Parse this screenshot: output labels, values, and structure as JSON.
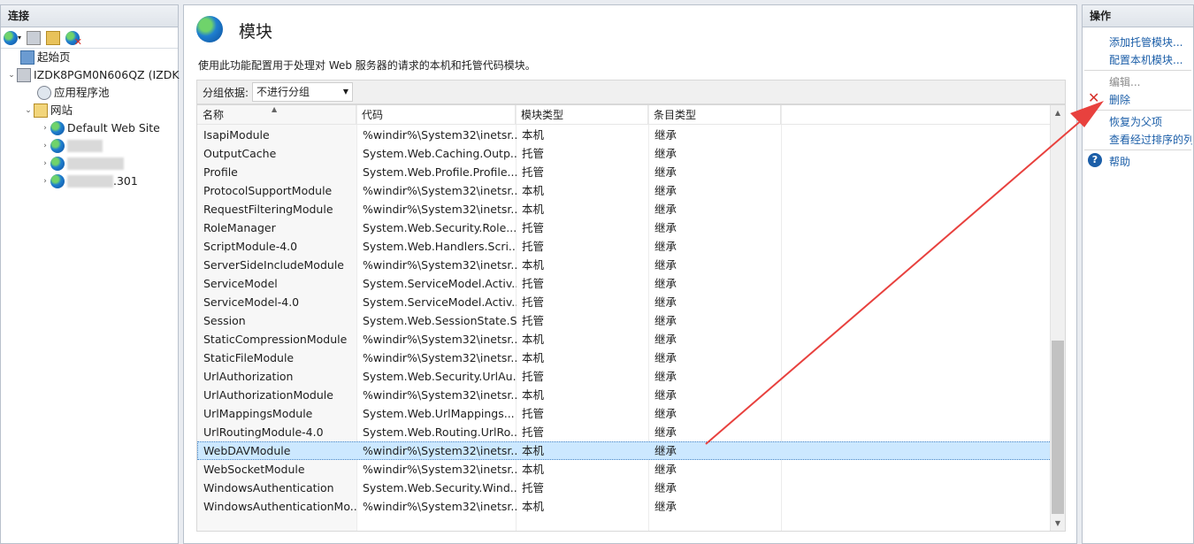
{
  "connections": {
    "title": "连接",
    "toolbar_icons": [
      "connect-globe-icon",
      "save-icon",
      "up-folder-icon",
      "disconnect-icon"
    ],
    "tree": {
      "start_page": "起始页",
      "server": "IZDK8PGM0N606QZ (IZDK",
      "app_pools": "应用程序池",
      "sites": "网站",
      "default_site": "Default Web Site",
      "site_blurred_3_suffix": ".301"
    }
  },
  "main": {
    "title": "模块",
    "description": "使用此功能配置用于处理对 Web 服务器的请求的本机和托管代码模块。",
    "group_label": "分组依据:",
    "group_value": "不进行分组",
    "columns": [
      "名称",
      "代码",
      "模块类型",
      "条目类型"
    ],
    "rows": [
      {
        "name": "IsapiModule",
        "code": "%windir%\\System32\\inetsr...",
        "type": "本机",
        "entry": "继承"
      },
      {
        "name": "OutputCache",
        "code": "System.Web.Caching.Outp...",
        "type": "托管",
        "entry": "继承"
      },
      {
        "name": "Profile",
        "code": "System.Web.Profile.Profile...",
        "type": "托管",
        "entry": "继承"
      },
      {
        "name": "ProtocolSupportModule",
        "code": "%windir%\\System32\\inetsr...",
        "type": "本机",
        "entry": "继承"
      },
      {
        "name": "RequestFilteringModule",
        "code": "%windir%\\System32\\inetsr...",
        "type": "本机",
        "entry": "继承"
      },
      {
        "name": "RoleManager",
        "code": "System.Web.Security.Role...",
        "type": "托管",
        "entry": "继承"
      },
      {
        "name": "ScriptModule-4.0",
        "code": "System.Web.Handlers.Scri...",
        "type": "托管",
        "entry": "继承"
      },
      {
        "name": "ServerSideIncludeModule",
        "code": "%windir%\\System32\\inetsr...",
        "type": "本机",
        "entry": "继承"
      },
      {
        "name": "ServiceModel",
        "code": "System.ServiceModel.Activ...",
        "type": "托管",
        "entry": "继承"
      },
      {
        "name": "ServiceModel-4.0",
        "code": "System.ServiceModel.Activ...",
        "type": "托管",
        "entry": "继承"
      },
      {
        "name": "Session",
        "code": "System.Web.SessionState.S...",
        "type": "托管",
        "entry": "继承"
      },
      {
        "name": "StaticCompressionModule",
        "code": "%windir%\\System32\\inetsr...",
        "type": "本机",
        "entry": "继承"
      },
      {
        "name": "StaticFileModule",
        "code": "%windir%\\System32\\inetsr...",
        "type": "本机",
        "entry": "继承"
      },
      {
        "name": "UrlAuthorization",
        "code": "System.Web.Security.UrlAu...",
        "type": "托管",
        "entry": "继承"
      },
      {
        "name": "UrlAuthorizationModule",
        "code": "%windir%\\System32\\inetsr...",
        "type": "本机",
        "entry": "继承"
      },
      {
        "name": "UrlMappingsModule",
        "code": "System.Web.UrlMappings...",
        "type": "托管",
        "entry": "继承"
      },
      {
        "name": "UrlRoutingModule-4.0",
        "code": "System.Web.Routing.UrlRo...",
        "type": "托管",
        "entry": "继承"
      },
      {
        "name": "WebDAVModule",
        "code": "%windir%\\System32\\inetsr...",
        "type": "本机",
        "entry": "继承",
        "selected": true
      },
      {
        "name": "WebSocketModule",
        "code": "%windir%\\System32\\inetsr...",
        "type": "本机",
        "entry": "继承"
      },
      {
        "name": "WindowsAuthentication",
        "code": "System.Web.Security.Wind...",
        "type": "托管",
        "entry": "继承"
      },
      {
        "name": "WindowsAuthenticationMo...",
        "code": "%windir%\\System32\\inetsr...",
        "type": "本机",
        "entry": "继承"
      }
    ]
  },
  "actions": {
    "title": "操作",
    "add_managed": "添加托管模块...",
    "configure_native": "配置本机模块...",
    "edit": "编辑...",
    "delete": "删除",
    "revert": "恢复为父项",
    "view_ordered": "查看经过排序的列表...",
    "help": "帮助"
  },
  "colors": {
    "link": "#1b5ea8",
    "selection": "#cce8ff",
    "annotation_arrow": "#e8413e",
    "delete_icon": "#d6312b"
  }
}
